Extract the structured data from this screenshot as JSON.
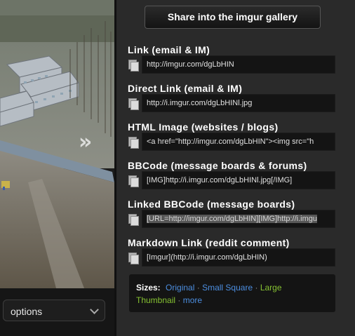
{
  "preview": {
    "next_icon": "chevron-right-double-icon",
    "options_label": "options",
    "options_icon": "chevron-down-icon"
  },
  "share_button": "Share into the imgur gallery",
  "fields": [
    {
      "title": "Link (email & IM)",
      "value": "http://imgur.com/dgLbHIN",
      "selected": false
    },
    {
      "title": "Direct Link (email & IM)",
      "value": "http://i.imgur.com/dgLbHINl.jpg",
      "selected": false
    },
    {
      "title": "HTML Image (websites / blogs)",
      "value": "<a href=\"http://imgur.com/dgLbHIN\"><img src=\"h",
      "selected": false
    },
    {
      "title": "BBCode (message boards & forums)",
      "value": "[IMG]http://i.imgur.com/dgLbHINl.jpg[/IMG]",
      "selected": false
    },
    {
      "title": "Linked BBCode (message boards)",
      "value": "[URL=http://imgur.com/dgLbHIN][IMG]http://i.imgu",
      "selected": true
    },
    {
      "title": "Markdown Link (reddit comment)",
      "value": "[Imgur](http://i.imgur.com/dgLbHIN)",
      "selected": false
    }
  ],
  "copy_icon": "copy-icon",
  "sizes": {
    "label": "Sizes:",
    "options": [
      "Original",
      "Small Square",
      "Large Thumbnail",
      "more"
    ],
    "large_word": "Large",
    "thumbnail_word": "Thumbnail",
    "separator": "·"
  },
  "colors": {
    "link_blue": "#4c8ee0",
    "link_green": "#86c232",
    "panel_bg": "#2a2a2a",
    "field_bg": "#141414"
  }
}
